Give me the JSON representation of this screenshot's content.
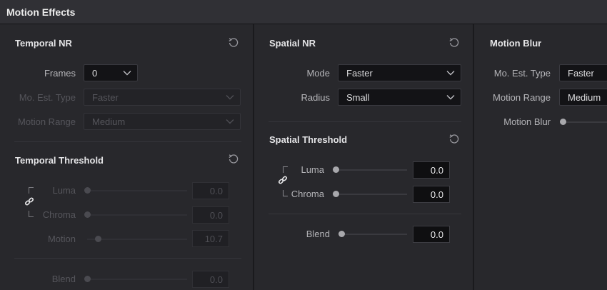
{
  "window": {
    "title": "Motion Effects"
  },
  "temporal_nr": {
    "title": "Temporal NR",
    "frames": {
      "label": "Frames",
      "value": "0"
    },
    "mo_est_type": {
      "label": "Mo. Est. Type",
      "value": "Faster"
    },
    "motion_range": {
      "label": "Motion Range",
      "value": "Medium"
    }
  },
  "temporal_threshold": {
    "title": "Temporal Threshold",
    "luma": {
      "label": "Luma",
      "value": "0.0"
    },
    "chroma": {
      "label": "Chroma",
      "value": "0.0"
    },
    "motion": {
      "label": "Motion",
      "value": "10.7"
    },
    "blend": {
      "label": "Blend",
      "value": "0.0"
    }
  },
  "spatial_nr": {
    "title": "Spatial NR",
    "mode": {
      "label": "Mode",
      "value": "Faster"
    },
    "radius": {
      "label": "Radius",
      "value": "Small"
    }
  },
  "spatial_threshold": {
    "title": "Spatial Threshold",
    "luma": {
      "label": "Luma",
      "value": "0.0"
    },
    "chroma": {
      "label": "Chroma",
      "value": "0.0"
    },
    "blend": {
      "label": "Blend",
      "value": "0.0"
    }
  },
  "motion_blur": {
    "title": "Motion Blur",
    "mo_est_type": {
      "label": "Mo. Est. Type",
      "value": "Faster"
    },
    "motion_range": {
      "label": "Motion Range",
      "value": "Medium"
    },
    "motion_blur": {
      "label": "Motion Blur"
    }
  },
  "icons": {
    "reset": "reset-icon",
    "link": "link-icon",
    "chevron": "chevron-down-icon"
  }
}
